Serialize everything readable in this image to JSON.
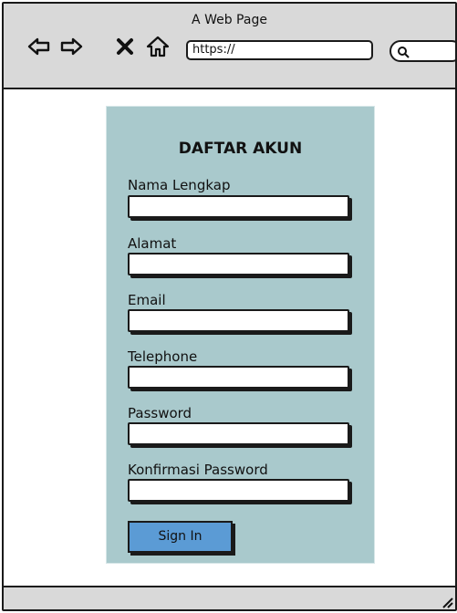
{
  "window": {
    "title": "A Web Page",
    "url": "https://"
  },
  "toolbar": {
    "icons": [
      "back-arrow-icon",
      "forward-arrow-icon",
      "close-icon",
      "home-icon",
      "search-icon"
    ]
  },
  "form": {
    "title": "DAFTAR AKUN",
    "fields": [
      {
        "label": "Nama Lengkap",
        "value": ""
      },
      {
        "label": "Alamat",
        "value": ""
      },
      {
        "label": "Email",
        "value": ""
      },
      {
        "label": "Telephone",
        "value": ""
      },
      {
        "label": "Password",
        "value": ""
      },
      {
        "label": "Konfirmasi Password",
        "value": ""
      }
    ],
    "submit_label": "Sign In"
  },
  "colors": {
    "panel_bg": "#a9c9cc",
    "button_bg": "#5b9bd5",
    "chrome_bg": "#d9d9d9"
  }
}
